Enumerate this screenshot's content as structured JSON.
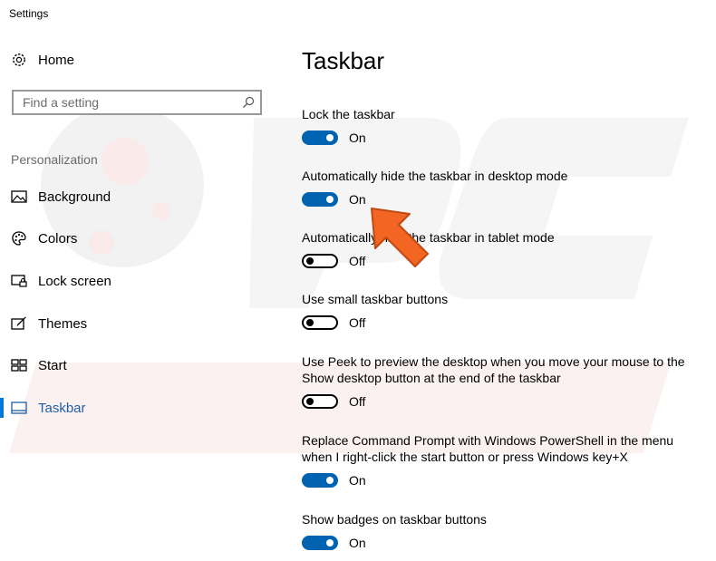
{
  "window": {
    "title": "Settings"
  },
  "sidebar": {
    "home_label": "Home",
    "search_placeholder": "Find a setting",
    "section_label": "Personalization",
    "items": [
      {
        "label": "Background",
        "icon": "picture-icon"
      },
      {
        "label": "Colors",
        "icon": "palette-icon"
      },
      {
        "label": "Lock screen",
        "icon": "lock-screen-icon"
      },
      {
        "label": "Themes",
        "icon": "brush-icon"
      },
      {
        "label": "Start",
        "icon": "start-tiles-icon"
      },
      {
        "label": "Taskbar",
        "icon": "taskbar-icon",
        "active": true
      }
    ]
  },
  "main": {
    "title": "Taskbar",
    "settings": [
      {
        "label": "Lock the taskbar",
        "state": "On",
        "on": true
      },
      {
        "label": "Automatically hide the taskbar in desktop mode",
        "state": "On",
        "on": true
      },
      {
        "label": "Automatically hide the taskbar in tablet mode",
        "state": "Off",
        "on": false
      },
      {
        "label": "Use small taskbar buttons",
        "state": "Off",
        "on": false
      },
      {
        "label": "Use Peek to preview the desktop when you move your mouse to the Show desktop button at the end of the taskbar",
        "state": "Off",
        "on": false
      },
      {
        "label": "Replace Command Prompt with Windows PowerShell in the menu when I right-click the start button or press Windows key+X",
        "state": "On",
        "on": true
      },
      {
        "label": "Show badges on taskbar buttons",
        "state": "On",
        "on": true
      }
    ]
  },
  "colors": {
    "accent": "#0063b1",
    "active_text": "#1f5fa8",
    "annotation_arrow": "#f26522"
  }
}
